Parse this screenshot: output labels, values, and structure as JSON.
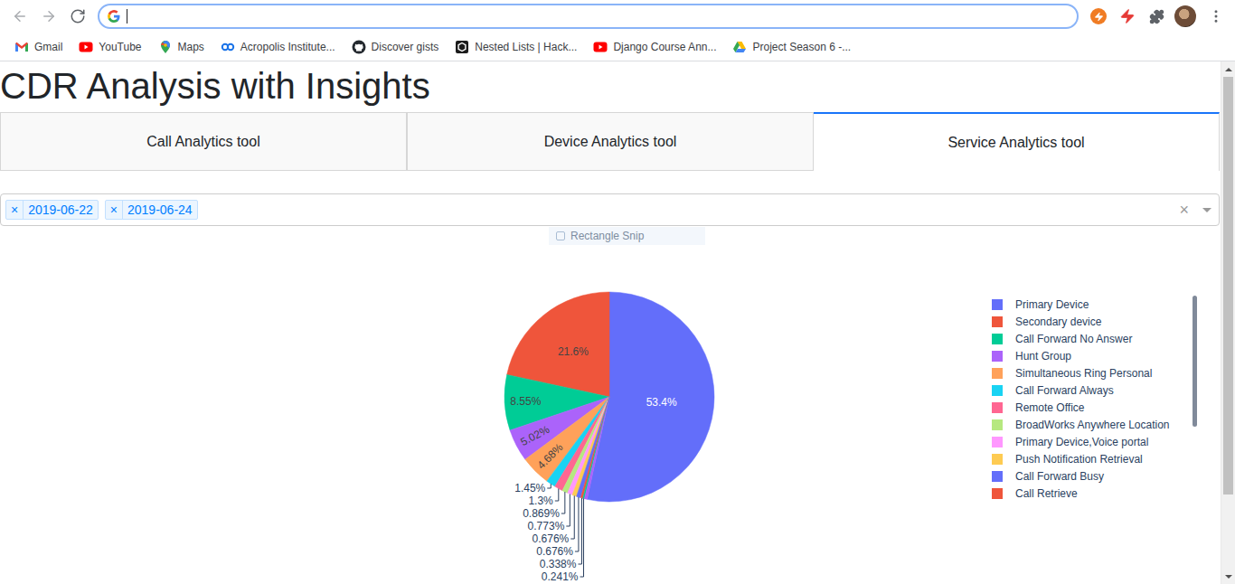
{
  "browser": {
    "nav": [
      {
        "kind": "back",
        "disabled": true
      },
      {
        "kind": "forward",
        "disabled": true
      },
      {
        "kind": "reload",
        "disabled": false
      }
    ],
    "bookmarks": [
      {
        "label": "Gmail",
        "kind": "gmail"
      },
      {
        "label": "YouTube",
        "kind": "youtube"
      },
      {
        "label": "Maps",
        "kind": "maps"
      },
      {
        "label": "Acropolis Institute...",
        "kind": "acropolis"
      },
      {
        "label": "Discover gists",
        "kind": "github"
      },
      {
        "label": "Nested Lists | Hack...",
        "kind": "hackerrank"
      },
      {
        "label": "Django Course Ann...",
        "kind": "youtube"
      },
      {
        "label": "Project Season 6 -...",
        "kind": "drive"
      }
    ]
  },
  "page": {
    "title": "CDR Analysis with Insights"
  },
  "tabs": [
    {
      "label": "Call Analytics tool",
      "selected": false
    },
    {
      "label": "Device Analytics tool",
      "selected": false
    },
    {
      "label": "Service Analytics tool",
      "selected": true
    }
  ],
  "date_filter": {
    "values": [
      {
        "label": "2019-06-22",
        "remove": "×"
      },
      {
        "label": "2019-06-24",
        "remove": "×"
      }
    ],
    "clear": "×"
  },
  "snip_hint": {
    "label": "Rectangle Snip"
  },
  "chart": {
    "slices": [
      {
        "value": 53.4,
        "text": "53.4%",
        "color": "#636efa"
      },
      {
        "value": 21.6,
        "text": "21.6%",
        "color": "#ef553b"
      },
      {
        "value": 8.55,
        "text": "8.55%",
        "color": "#00cc96"
      },
      {
        "value": 5.02,
        "text": "5.02%",
        "color": "#ab63fa"
      },
      {
        "value": 4.68,
        "text": "4.68%",
        "color": "#ffa15a"
      },
      {
        "value": 1.45,
        "text": "1.45%",
        "color": "#19d3f3"
      },
      {
        "value": 1.3,
        "text": "1.3%",
        "color": "#ff6692"
      },
      {
        "value": 0.869,
        "text": "0.869%",
        "color": "#b6e880"
      },
      {
        "value": 0.773,
        "text": "0.773%",
        "color": "#ff97ff"
      },
      {
        "value": 0.676,
        "text": "0.676%",
        "color": "#fecb52"
      },
      {
        "value": 0.676,
        "text": "0.676%",
        "color": "#636efa"
      },
      {
        "value": 0.338,
        "text": "0.338%",
        "color": "#ef553b"
      },
      {
        "value": 0.241,
        "text": "0.241%",
        "color": "#00cc96"
      },
      {
        "value": 0.427,
        "color": "#ab63fa"
      }
    ],
    "legend": [
      {
        "label": "Primary Device",
        "color": "#636efa"
      },
      {
        "label": "Secondary device",
        "color": "#ef553b"
      },
      {
        "label": "Call Forward No Answer",
        "color": "#00cc96"
      },
      {
        "label": "Hunt Group",
        "color": "#ab63fa"
      },
      {
        "label": "Simultaneous Ring Personal",
        "color": "#ffa15a"
      },
      {
        "label": "Call Forward Always",
        "color": "#19d3f3"
      },
      {
        "label": "Remote Office",
        "color": "#ff6692"
      },
      {
        "label": "BroadWorks Anywhere Location",
        "color": "#b6e880"
      },
      {
        "label": "Primary Device,Voice portal",
        "color": "#ff97ff"
      },
      {
        "label": "Push Notification Retrieval",
        "color": "#fecb52"
      },
      {
        "label": "Call Forward Busy",
        "color": "#636efa"
      },
      {
        "label": "Call Retrieve",
        "color": "#ef553b"
      }
    ]
  }
}
